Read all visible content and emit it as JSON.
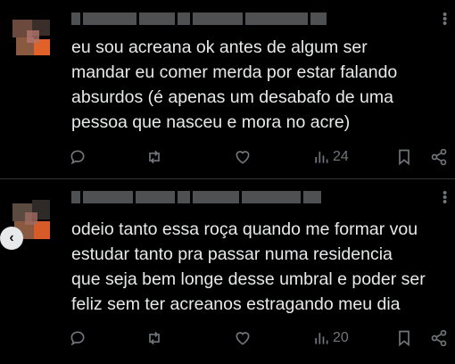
{
  "tweets": [
    {
      "text": "eu sou acreana ok antes de algum ser\nmandar eu comer merda por estar falando\nabsurdos (é apenas um desabafo de uma\npessoa que nasceu e mora no acre)",
      "views": "24"
    },
    {
      "text": "odeio tanto essa roça quando me formar vou\nestudar tanto pra passar numa residencia\nque seja bem longe desse umbral e poder ser\nfeliz sem ter acreanos estragando meu dia",
      "views": "20"
    }
  ],
  "icons": {
    "reply": "reply-icon",
    "retweet": "retweet-icon",
    "like": "heart-icon",
    "views": "views-icon",
    "bookmark": "bookmark-icon",
    "share": "share-icon",
    "more": "more-icon",
    "prev": "chevron-left-icon"
  },
  "colors": {
    "background": "#000000",
    "text": "#e7e9ea",
    "muted": "#71767b",
    "divider": "#2f3336"
  }
}
